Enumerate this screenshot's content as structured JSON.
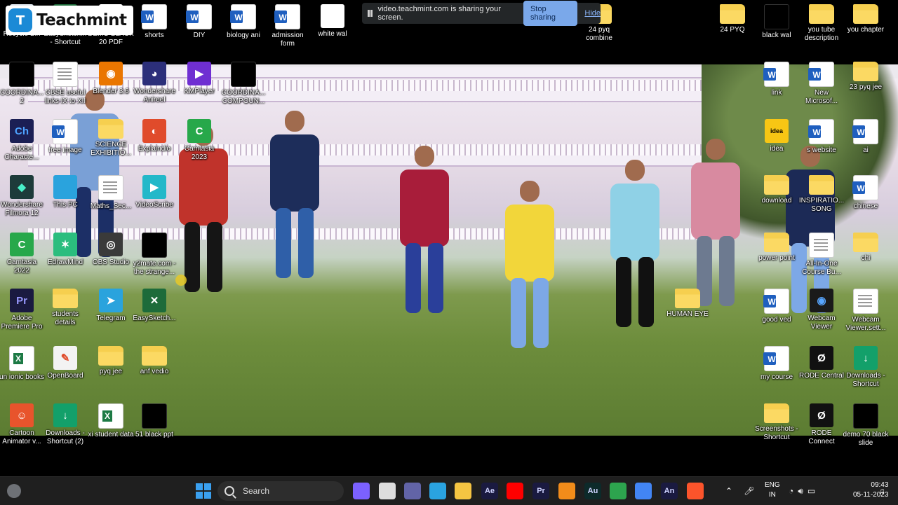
{
  "overlay": {
    "brand": "Teachmint",
    "logo_glyph": "T"
  },
  "sharing_bar": {
    "message": "video.teachmint.com is sharing your screen.",
    "stop_label": "Stop sharing",
    "hide_label": "Hide"
  },
  "desktop": {
    "icons": [
      {
        "label": "Recycle Bin",
        "icon": "recycle-bin-icon"
      },
      {
        "label": "EasySketch... - Shortcut",
        "icon": "easysketch-icon"
      },
      {
        "label": "DEMO BLACK 20 PDF",
        "icon": "pdf-icon"
      },
      {
        "label": "shorts",
        "icon": "word-doc-icon"
      },
      {
        "label": "DIY",
        "icon": "word-doc-icon"
      },
      {
        "label": "biology ani",
        "icon": "word-doc-icon"
      },
      {
        "label": "admission form",
        "icon": "word-doc-icon"
      },
      {
        "label": "white wal",
        "icon": "white-image-icon"
      },
      {
        "label": "24 pyq combine",
        "icon": "folder-icon"
      },
      {
        "label": "24 PYQ",
        "icon": "folder-icon"
      },
      {
        "label": "black wal",
        "icon": "black-image-icon"
      },
      {
        "label": "you tube description",
        "icon": "folder-icon"
      },
      {
        "label": "you chapter",
        "icon": "folder-icon"
      },
      {
        "label": "COORDINA... 2",
        "icon": "video-file-icon"
      },
      {
        "label": "CBSE useful links IX to XII",
        "icon": "document-icon"
      },
      {
        "label": "Blender 3.6",
        "icon": "blender-icon"
      },
      {
        "label": "Wondershare Anireel",
        "icon": "anireel-icon"
      },
      {
        "label": "KMPlayer",
        "icon": "kmplayer-icon"
      },
      {
        "label": "COORDINA... COMPOUN...",
        "icon": "video-file-icon"
      },
      {
        "label": "link",
        "icon": "word-doc-icon"
      },
      {
        "label": "New Microsof...",
        "icon": "word-doc-icon"
      },
      {
        "label": "23 pyq jee",
        "icon": "folder-icon"
      },
      {
        "label": "Adobe Characte...",
        "icon": "adobe-character-icon"
      },
      {
        "label": "free image",
        "icon": "word-doc-icon"
      },
      {
        "label": "SCIENCE EXHIBITIO...",
        "icon": "folder-icon"
      },
      {
        "label": "Explaindio",
        "icon": "explaindio-icon"
      },
      {
        "label": "Camtasia 2023",
        "icon": "camtasia-icon"
      },
      {
        "label": "idea",
        "icon": "idea-icon"
      },
      {
        "label": "s website",
        "icon": "word-doc-icon"
      },
      {
        "label": "ai",
        "icon": "word-doc-icon"
      },
      {
        "label": "Wondershare Filmora 12",
        "icon": "filmora-icon"
      },
      {
        "label": "This PC",
        "icon": "this-pc-icon"
      },
      {
        "label": "Maths_Sec...",
        "icon": "document-icon"
      },
      {
        "label": "VideoScribe",
        "icon": "videoscribe-icon"
      },
      {
        "label": "download",
        "icon": "folder-icon"
      },
      {
        "label": "INSPIRATIO... SONG",
        "icon": "folder-icon"
      },
      {
        "label": "chinese",
        "icon": "word-doc-icon"
      },
      {
        "label": "Camtasia 2022",
        "icon": "camtasia-icon"
      },
      {
        "label": "EdrawMind",
        "icon": "edrawmind-icon"
      },
      {
        "label": "OBS Studio",
        "icon": "obs-icon"
      },
      {
        "label": "y2mate.com - the strange...",
        "icon": "video-file-icon"
      },
      {
        "label": "power point",
        "icon": "folder-icon"
      },
      {
        "label": "All-In-One Course Bu...",
        "icon": "document-icon"
      },
      {
        "label": "chi",
        "icon": "folder-icon"
      },
      {
        "label": "Adobe Premiere Pro",
        "icon": "premiere-icon"
      },
      {
        "label": "students details",
        "icon": "folder-icon"
      },
      {
        "label": "Telegram",
        "icon": "telegram-icon"
      },
      {
        "label": "EasySketch...",
        "icon": "easysketch-icon"
      },
      {
        "label": "HUMAN EYE",
        "icon": "folder-icon"
      },
      {
        "label": "good ved",
        "icon": "word-doc-icon"
      },
      {
        "label": "Webcam Viewer",
        "icon": "webcam-icon"
      },
      {
        "label": "Webcam Viewer.sett...",
        "icon": "blank-file-icon"
      },
      {
        "label": "un ionic books",
        "icon": "excel-icon"
      },
      {
        "label": "OpenBoard",
        "icon": "openboard-icon"
      },
      {
        "label": "pyq jee",
        "icon": "folder-icon"
      },
      {
        "label": "anf vedio",
        "icon": "folder-icon"
      },
      {
        "label": "my course",
        "icon": "word-doc-icon"
      },
      {
        "label": "RODE Central",
        "icon": "rode-icon"
      },
      {
        "label": "Downloads - Shortcut",
        "icon": "downloads-shortcut-icon"
      },
      {
        "label": "Cartoon Animator v...",
        "icon": "cartoon-animator-icon"
      },
      {
        "label": "Downloads - Shortcut (2)",
        "icon": "downloads-shortcut-icon"
      },
      {
        "label": "xi student data",
        "icon": "excel-icon"
      },
      {
        "label": "51 black ppt",
        "icon": "pptx-black-icon"
      },
      {
        "label": "Screenshots - Shortcut",
        "icon": "folder-icon"
      },
      {
        "label": "RODE Connect",
        "icon": "rode-icon"
      },
      {
        "label": "demo 70 black slide",
        "icon": "pptx-black-icon"
      }
    ]
  },
  "taskbar": {
    "search_placeholder": "Search",
    "apps": [
      {
        "name": "copilot-icon",
        "glyph": "",
        "color": "#7b61ff"
      },
      {
        "name": "task-view-icon",
        "glyph": "",
        "color": "#dddddd"
      },
      {
        "name": "teams-icon",
        "glyph": "",
        "color": "#6264a7"
      },
      {
        "name": "edge-icon",
        "glyph": "",
        "color": "#2aa3e0"
      },
      {
        "name": "file-explorer-icon",
        "glyph": "",
        "color": "#f5c542"
      },
      {
        "name": "after-effects-icon",
        "glyph": "Ae",
        "color": "#1a1a40"
      },
      {
        "name": "youtube-icon",
        "glyph": "",
        "color": "#ff0000"
      },
      {
        "name": "premiere-taskbar-icon",
        "glyph": "Pr",
        "color": "#1a1a40"
      },
      {
        "name": "vlc-icon",
        "glyph": "",
        "color": "#f28c1a"
      },
      {
        "name": "audition-icon",
        "glyph": "Au",
        "color": "#0d2a2a"
      },
      {
        "name": "camtasia-taskbar-icon",
        "glyph": "",
        "color": "#2da44e"
      },
      {
        "name": "chrome-icon",
        "glyph": "",
        "color": "#4285f4"
      },
      {
        "name": "animate-icon",
        "glyph": "An",
        "color": "#1a1a40"
      },
      {
        "name": "brave-icon",
        "glyph": "",
        "color": "#fb542b"
      }
    ],
    "language_top": "ENG",
    "language_bottom": "IN",
    "time": "09:43",
    "date": "05-11-2023"
  }
}
